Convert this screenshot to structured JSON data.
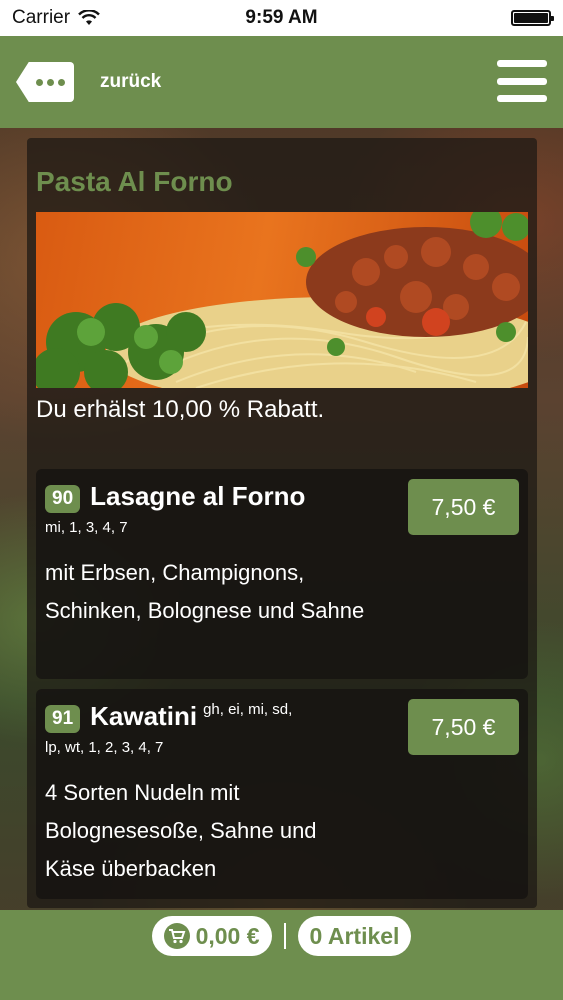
{
  "status_bar": {
    "carrier": "Carrier",
    "time": "9:59 AM"
  },
  "header": {
    "back_label": "zurück",
    "accent_color": "#6e8e4e"
  },
  "category": {
    "title": "Pasta Al Forno",
    "discount_text": "Du erhälst 10,00 % Rabatt."
  },
  "items": [
    {
      "number": "90",
      "name": "Lasagne al Forno",
      "name_allergens": "",
      "allergens": "mi, 1, 3, 4, 7",
      "description": "mit Erbsen, Champignons, Schinken, Bolognese und Sahne",
      "price": "7,50 €"
    },
    {
      "number": "91",
      "name": "Kawatini",
      "name_allergens": "gh, ei, mi, sd,",
      "allergens": "lp, wt, 1, 2, 3, 4, 7",
      "description": "4 Sorten Nudeln mit Bolognesesoße, Sahne und Käse überbacken",
      "price": "7,50 €"
    }
  ],
  "footer": {
    "cart_amount": "0,00 €",
    "cart_count": "0 Artikel"
  }
}
